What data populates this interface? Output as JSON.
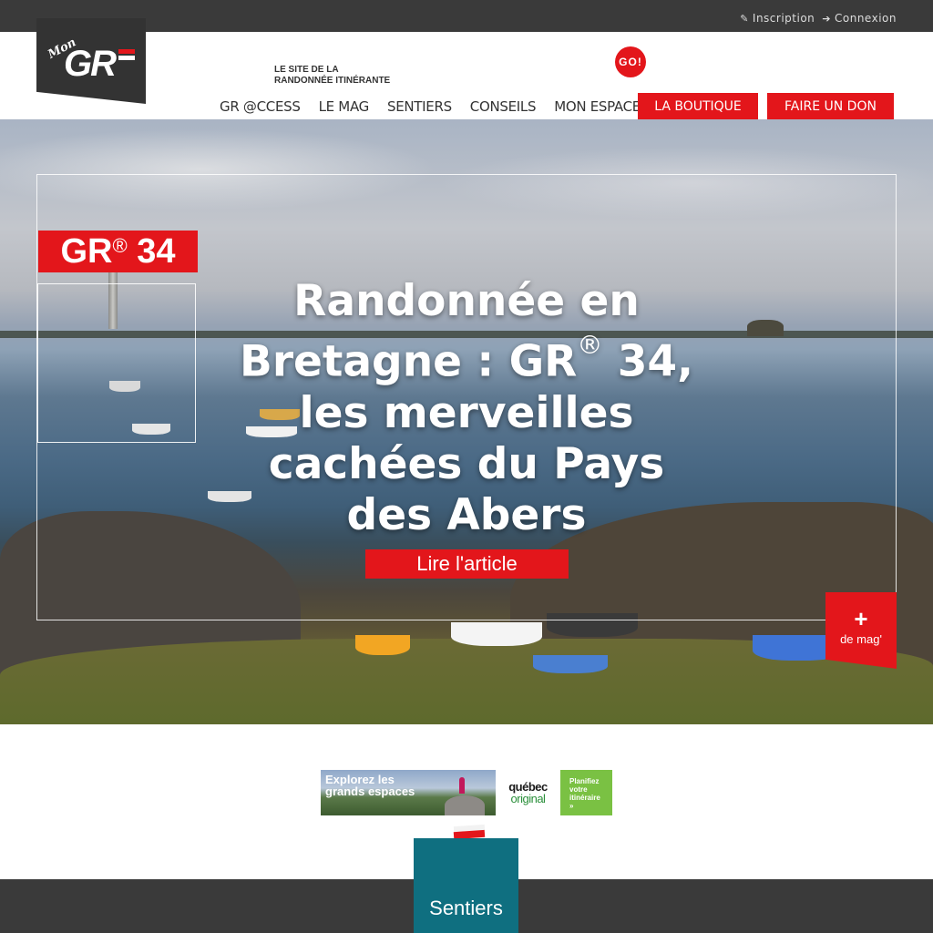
{
  "topbar": {
    "inscription": "Inscription",
    "connexion": "Connexion"
  },
  "header": {
    "logo_mon": "Mon",
    "logo_gr": "GR",
    "tagline_line1": "LE SITE DE LA",
    "tagline_line2": "RANDONNÉE ITINÉRANTE",
    "go_badge": "GO!"
  },
  "nav": {
    "items": [
      "GR @CCESS",
      "LE MAG",
      "SENTIERS",
      "CONSEILS",
      "MON ESPACE"
    ],
    "shop": "LA BOUTIQUE",
    "donate": "FAIRE UN DON"
  },
  "hero": {
    "badge_gr": "GR",
    "badge_reg": "®",
    "badge_num": "34",
    "title_part1": "Randonnée en Bretagne : GR",
    "title_reg": "®",
    "title_part2": "34, les merveilles cachées du Pays des Abers",
    "read_button": "Lire l'article",
    "more_plus": "+",
    "more_label": "de mag'"
  },
  "ad": {
    "headline_line1": "Explorez les",
    "headline_line2": "grands espaces",
    "brand_line1": "québec",
    "brand_line2": "original",
    "cta_line1": "Planifiez",
    "cta_line2": "votre",
    "cta_line3": "itinéraire",
    "cta_line4": "»"
  },
  "bottom": {
    "tab_label": "Sentiers"
  },
  "colors": {
    "brand_red": "#e3161b",
    "dark_bar": "#3a3a3a",
    "teal_tab": "#0f6f80",
    "ad_green": "#7ac143"
  },
  "icons": {
    "inscription": "edit-icon",
    "connexion": "sign-in-icon"
  }
}
